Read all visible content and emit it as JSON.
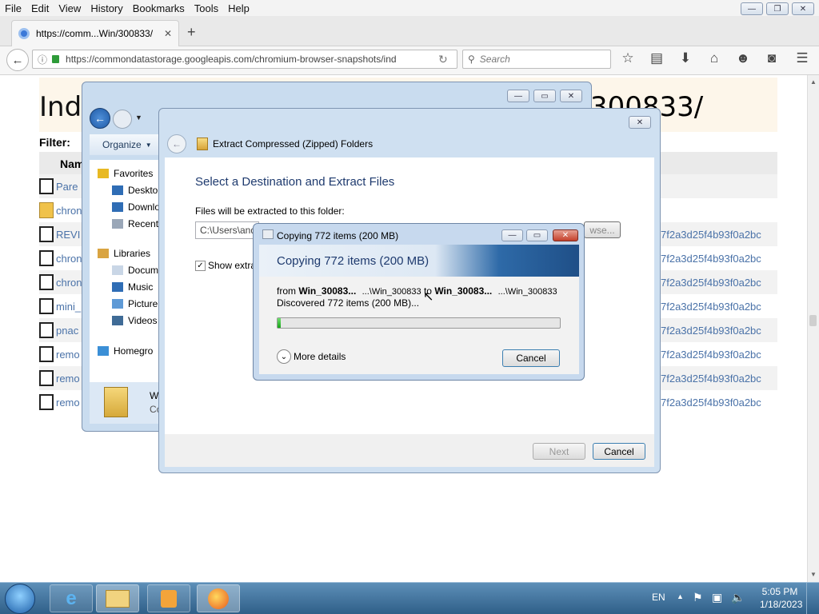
{
  "browser": {
    "menu": [
      "File",
      "Edit",
      "View",
      "History",
      "Bookmarks",
      "Tools",
      "Help"
    ],
    "tab_title": "https://comm...Win/300833/",
    "url": "https://commondatastorage.googleapis.com/chromium-browser-snapshots/ind",
    "search_placeholder": "Search"
  },
  "page": {
    "title_left": "Inde",
    "title_right": "300833/",
    "filter_label": "Filter:",
    "name_header": "Nam",
    "rows": [
      {
        "name": "Pare",
        "hash": ""
      },
      {
        "name": "chron",
        "hash": ""
      },
      {
        "name": "REVI",
        "hash": "7f2a3d25f4b93f0a2bc"
      },
      {
        "name": "chron",
        "hash": "7f2a3d25f4b93f0a2bc"
      },
      {
        "name": "chron",
        "hash": "7f2a3d25f4b93f0a2bc"
      },
      {
        "name": "mini_",
        "hash": "7f2a3d25f4b93f0a2bc"
      },
      {
        "name": "pnac",
        "hash": "7f2a3d25f4b93f0a2bc"
      },
      {
        "name": "remo",
        "hash": "7f2a3d25f4b93f0a2bc"
      },
      {
        "name": "remo",
        "hash": "7f2a3d25f4b93f0a2bc"
      },
      {
        "name": "remo",
        "hash": "7f2a3d25f4b93f0a2bc"
      }
    ]
  },
  "explorer": {
    "organize": "Organize",
    "sidebar": [
      {
        "label": "Favorites",
        "icon": "star-icon"
      },
      {
        "label": "Deskto",
        "icon": "desktop-icon"
      },
      {
        "label": "Downlo",
        "icon": "downloads-icon"
      },
      {
        "label": "Recent",
        "icon": "recent-places-icon"
      },
      {
        "label": "Libraries",
        "icon": "libraries-icon"
      },
      {
        "label": "Docum",
        "icon": "documents-icon"
      },
      {
        "label": "Music",
        "icon": "music-icon"
      },
      {
        "label": "Picture",
        "icon": "pictures-icon"
      },
      {
        "label": "Videos",
        "icon": "videos-icon"
      },
      {
        "label": "Homegro",
        "icon": "homegroup-icon"
      }
    ],
    "preview_line1": "W",
    "preview_line2": "Co"
  },
  "wizard": {
    "title": "Extract Compressed (Zipped) Folders",
    "heading": "Select a Destination and Extract Files",
    "folder_label": "Files will be extracted to this folder:",
    "folder_value": "C:\\Users\\and",
    "browse": "wse...",
    "show_label": "Show extra",
    "next": "Next",
    "cancel": "Cancel"
  },
  "copy": {
    "title": "Copying 772 items (200 MB)",
    "heading": "Copying 772 items (200 MB)",
    "from_label": "from",
    "from_name": "Win_30083...",
    "from_path": "...\\Win_300833",
    "to_label": "to",
    "to_name": "Win_30083...",
    "to_path": "...\\Win_300833",
    "discovered": "Discovered 772 items (200 MB)...",
    "progress_fraction": 0.01,
    "more_details": "More details",
    "cancel": "Cancel"
  },
  "taskbar": {
    "lang": "EN",
    "time": "5:05 PM",
    "date": "1/18/2023"
  }
}
